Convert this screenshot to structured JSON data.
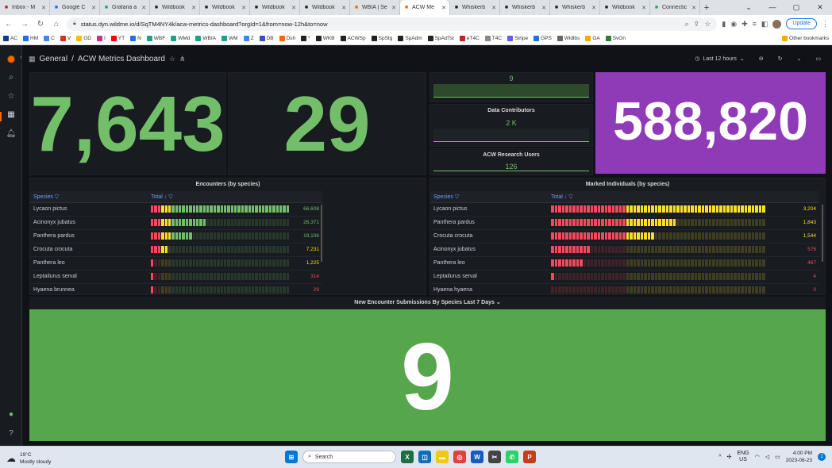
{
  "browser": {
    "tabs": [
      {
        "label": "Inbox - M",
        "icon": "mail-icon",
        "color": "#c5221f"
      },
      {
        "label": "Google C",
        "icon": "calendar-icon",
        "color": "#1a73e8"
      },
      {
        "label": "Grafana a",
        "icon": "wildme-icon",
        "color": "#1aa38b"
      },
      {
        "label": "Wildbook",
        "icon": "wildbook-icon",
        "color": "#222222"
      },
      {
        "label": "Wildbook",
        "icon": "wildbook-icon",
        "color": "#222222"
      },
      {
        "label": "Wildbook",
        "icon": "wildbook-icon",
        "color": "#222222"
      },
      {
        "label": "Wildbook",
        "icon": "wildbook-icon",
        "color": "#222222"
      },
      {
        "label": "WBIA | Se",
        "icon": "wbia-icon",
        "color": "#e37400"
      },
      {
        "label": "ACW Me",
        "icon": "grafana-icon",
        "color": "#f46800",
        "active": true
      },
      {
        "label": "Whiskerb",
        "icon": "whisker-icon",
        "color": "#222222"
      },
      {
        "label": "Whiskerb",
        "icon": "whisker-icon",
        "color": "#222222"
      },
      {
        "label": "Whiskerb",
        "icon": "whisker-icon",
        "color": "#222222"
      },
      {
        "label": "Wildbook",
        "icon": "wildbook-icon",
        "color": "#222222"
      },
      {
        "label": "Connectic",
        "icon": "maps-pin-icon",
        "color": "#34a853"
      }
    ],
    "url": "status.dyn.wildme.io/d/SqTM4NY4k/acw-metrics-dashboard?orgId=1&from=now-12h&to=now",
    "update_label": "Update",
    "bookmarks": [
      {
        "label": "AC",
        "color": "#0b3d91"
      },
      {
        "label": "HM",
        "color": "#1a73e8"
      },
      {
        "label": "C",
        "color": "#4285f4"
      },
      {
        "label": "V",
        "color": "#d93025"
      },
      {
        "label": "GD",
        "color": "#fbbc04"
      },
      {
        "label": "I",
        "color": "#c13584"
      },
      {
        "label": "YT",
        "color": "#ff0000"
      },
      {
        "label": "N",
        "color": "#1a73e8"
      },
      {
        "label": "WBF",
        "color": "#1aa38b"
      },
      {
        "label": "WMd",
        "color": "#1aa38b"
      },
      {
        "label": "WBIA",
        "color": "#1aa38b"
      },
      {
        "label": "WM",
        "color": "#1aa38b"
      },
      {
        "label": "Z",
        "color": "#2d8cff"
      },
      {
        "label": "DB",
        "color": "#3a4fc7"
      },
      {
        "label": "Dsh",
        "color": "#f46800"
      },
      {
        "label": "*",
        "color": "#222222"
      },
      {
        "label": "WKB",
        "color": "#222222"
      },
      {
        "label": "ACWSp",
        "color": "#222222"
      },
      {
        "label": "SpStg",
        "color": "#222222"
      },
      {
        "label": "SpAdm",
        "color": "#222222"
      },
      {
        "label": "SpAdTst",
        "color": "#222222"
      },
      {
        "label": "eT4C",
        "color": "#c5221f"
      },
      {
        "label": "T4C",
        "color": "#888888"
      },
      {
        "label": "Stripe",
        "color": "#635bff"
      },
      {
        "label": "GPS",
        "color": "#1a73e8"
      },
      {
        "label": "Wldlbs",
        "color": "#666666"
      },
      {
        "label": "GA",
        "color": "#f9ab00"
      },
      {
        "label": "SvOn",
        "color": "#2e7d32"
      }
    ],
    "other_bookmarks": "Other bookmarks"
  },
  "dashboard": {
    "breadcrumb_folder": "General",
    "breadcrumb_sep": "/",
    "title": "ACW Metrics Dashboard",
    "time_range": "Last 12 hours",
    "stat1": "7,643",
    "stat2": "29",
    "small_top_value": "9",
    "data_contributors_title": "Data Contributors",
    "data_contributors_value": "2 K",
    "research_users_title": "ACW Research Users",
    "research_users_value": "126",
    "stat_purple": "588,820",
    "encounters_title": "Encounters (by species)",
    "marked_title": "Marked Individuals (by species)",
    "col_species": "Species",
    "col_total": "Total",
    "encounters": [
      {
        "species": "Lycaon pictus",
        "value": "66,608",
        "fill": 1.0,
        "color": "#73bf69"
      },
      {
        "species": "Acinonyx jubatus",
        "value": "26,371",
        "fill": 0.4,
        "color": "#73bf69"
      },
      {
        "species": "Panthera pardus",
        "value": "19,106",
        "fill": 0.3,
        "color": "#73bf69"
      },
      {
        "species": "Crocuta crocuta",
        "value": "7,231",
        "fill": 0.12,
        "color": "#fade2a"
      },
      {
        "species": "Panthera leo",
        "value": "1,225",
        "fill": 0.03,
        "color": "#fade2a"
      },
      {
        "species": "Leptailurus serval",
        "value": "314",
        "fill": 0.01,
        "color": "#f2495c"
      },
      {
        "species": "Hyaena brunnea",
        "value": "29",
        "fill": 0.005,
        "color": "#f2495c"
      }
    ],
    "marked": [
      {
        "species": "Lycaon pictus",
        "value": "3,204",
        "fill": 1.0,
        "color": "#fade2a"
      },
      {
        "species": "Panthera pardus",
        "value": "1,843",
        "fill": 0.58,
        "color": "#fade2a"
      },
      {
        "species": "Crocuta crocuta",
        "value": "1,544",
        "fill": 0.48,
        "color": "#fade2a"
      },
      {
        "species": "Acinonyx jubatus",
        "value": "576",
        "fill": 0.18,
        "color": "#f2495c"
      },
      {
        "species": "Panthera leo",
        "value": "467",
        "fill": 0.15,
        "color": "#f2495c"
      },
      {
        "species": "Leptailurus serval",
        "value": "4",
        "fill": 0.01,
        "color": "#f2495c"
      },
      {
        "species": "Hyaena hyaena",
        "value": "0",
        "fill": 0.0,
        "color": "#f2495c"
      }
    ],
    "new_submissions_title": "New Encounter Submissions By Species Last 7 Days",
    "new_submissions_value": "9",
    "colors": {
      "green": "#73bf69",
      "purple": "#8f3bb8",
      "bottom_green": "#56a64b"
    }
  },
  "taskbar": {
    "temp": "19°C",
    "weather": "Mostly cloudy",
    "search_placeholder": "Search",
    "lang1": "ENG",
    "lang2": "US",
    "time": "4:00 PM",
    "date": "2023-08-23"
  }
}
